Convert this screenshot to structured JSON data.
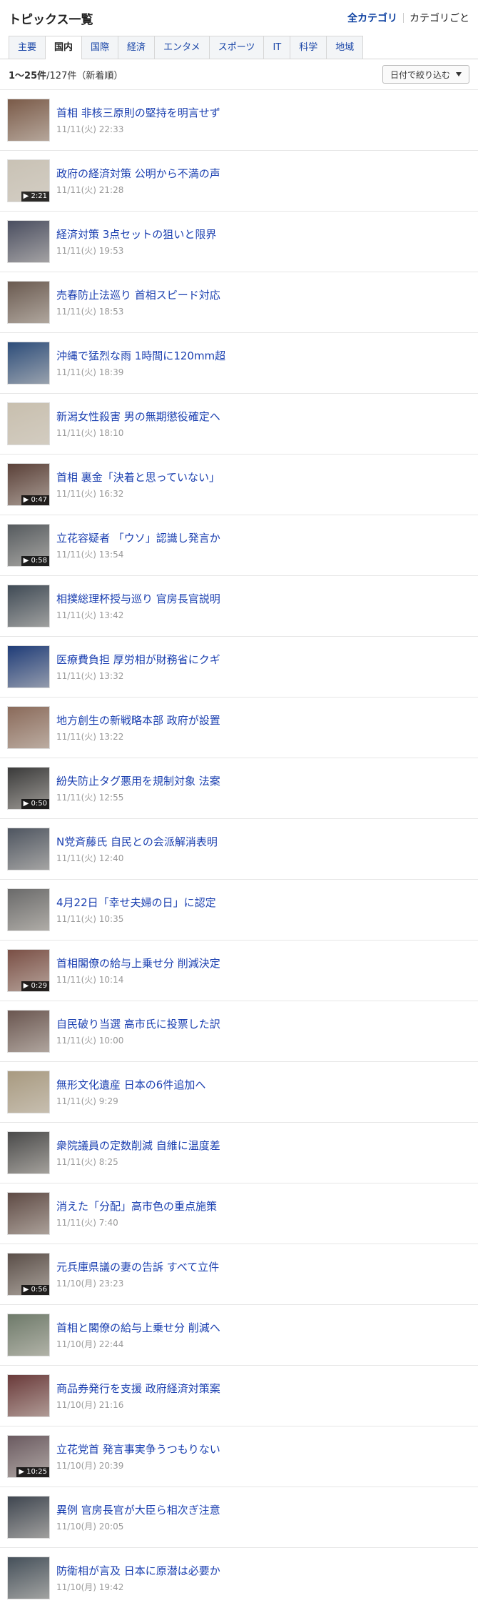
{
  "header": {
    "title": "トピックス一覧",
    "all_category": "全カテゴリ",
    "by_category": "カテゴリごと"
  },
  "tabs": [
    "主要",
    "国内",
    "国際",
    "経済",
    "エンタメ",
    "スポーツ",
    "IT",
    "科学",
    "地域"
  ],
  "active_tab": "国内",
  "count": {
    "range": "1〜25件",
    "rest": "/127件（新着順）"
  },
  "filter": {
    "label": "日付で絞り込む"
  },
  "items": [
    {
      "title": "首相 非核三原則の堅持を明言せず",
      "time": "11/11(火) 22:33",
      "badge": "",
      "color": "#7a5a48"
    },
    {
      "title": "政府の経済対策 公明から不満の声",
      "time": "11/11(火) 21:28",
      "badge": "2:21",
      "color": "#c9c2b5"
    },
    {
      "title": "経済対策 3点セットの狙いと限界",
      "time": "11/11(火) 19:53",
      "badge": "",
      "color": "#4a4e60"
    },
    {
      "title": "売春防止法巡り 首相スピード対応",
      "time": "11/11(火) 18:53",
      "badge": "",
      "color": "#6a5a50"
    },
    {
      "title": "沖縄で猛烈な雨 1時間に120mm超",
      "time": "11/11(火) 18:39",
      "badge": "",
      "color": "#2d4d7a"
    },
    {
      "title": "新潟女性殺害 男の無期懲役確定へ",
      "time": "11/11(火) 18:10",
      "badge": "",
      "color": "#c8bfae"
    },
    {
      "title": "首相 裏金「決着と思っていない」",
      "time": "11/11(火) 16:32",
      "badge": "0:47",
      "color": "#5a4038"
    },
    {
      "title": "立花容疑者 「ウソ」認識し発言か",
      "time": "11/11(火) 13:54",
      "badge": "0:58",
      "color": "#555a5e"
    },
    {
      "title": "相撲総理杯授与巡り 官房長官説明",
      "time": "11/11(火) 13:42",
      "badge": "",
      "color": "#3f4a55"
    },
    {
      "title": "医療費負担 厚労相が財務省にクギ",
      "time": "11/11(火) 13:32",
      "badge": "",
      "color": "#1f3c78"
    },
    {
      "title": "地方創生の新戦略本部 政府が設置",
      "time": "11/11(火) 13:22",
      "badge": "",
      "color": "#8a6a5a"
    },
    {
      "title": "紛失防止タグ悪用を規制対象 法案",
      "time": "11/11(火) 12:55",
      "badge": "0:50",
      "color": "#3a3a3a"
    },
    {
      "title": "N党斉藤氏 自民との会派解消表明",
      "time": "11/11(火) 12:40",
      "badge": "",
      "color": "#4e5560"
    },
    {
      "title": "4月22日「幸せ夫婦の日」に認定",
      "time": "11/11(火) 10:35",
      "badge": "",
      "color": "#6a6a6a"
    },
    {
      "title": "首相閣僚の給与上乗せ分 削減決定",
      "time": "11/11(火) 10:14",
      "badge": "0:29",
      "color": "#7a4f45"
    },
    {
      "title": "自民破り当選 高市氏に投票した訳",
      "time": "11/11(火) 10:00",
      "badge": "",
      "color": "#6a5650"
    },
    {
      "title": "無形文化遺産 日本の6件追加へ",
      "time": "11/11(火) 9:29",
      "badge": "",
      "color": "#a89a80"
    },
    {
      "title": "衆院議員の定数削減 自維に温度差",
      "time": "11/11(火) 8:25",
      "badge": "",
      "color": "#4a4a4a"
    },
    {
      "title": "消えた「分配」高市色の重点施策",
      "time": "11/11(火) 7:40",
      "badge": "",
      "color": "#5e4a44"
    },
    {
      "title": "元兵庫県議の妻の告訴 すべて立件",
      "time": "11/10(月) 23:23",
      "badge": "0:56",
      "color": "#5a4e48"
    },
    {
      "title": "首相と閣僚の給与上乗せ分 削減へ",
      "time": "11/10(月) 22:44",
      "badge": "",
      "color": "#6e7a6a"
    },
    {
      "title": "商品券発行を支援 政府経済対策案",
      "time": "11/10(月) 21:16",
      "badge": "",
      "color": "#6a3a3a"
    },
    {
      "title": "立花党首 発言事実争うつもりない",
      "time": "11/10(月) 20:39",
      "badge": "10:25",
      "color": "#6a5a60"
    },
    {
      "title": "異例 官房長官が大臣ら相次ぎ注意",
      "time": "11/10(月) 20:05",
      "badge": "",
      "color": "#3f4650"
    },
    {
      "title": "防衛相が言及 日本に原潜は必要か",
      "time": "11/10(月) 19:42",
      "badge": "",
      "color": "#45505a"
    }
  ]
}
